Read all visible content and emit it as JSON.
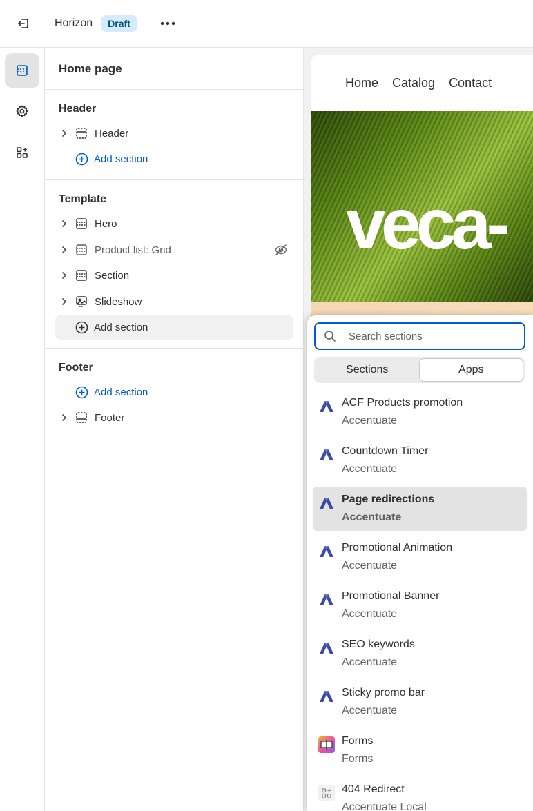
{
  "topbar": {
    "theme_name": "Horizon",
    "status_badge": "Draft"
  },
  "sidebar": {
    "page_title": "Home page",
    "groups": [
      {
        "title": "Header",
        "items": [
          {
            "label": "Header",
            "icon": "header-section-icon"
          }
        ],
        "add_label": "Add section"
      },
      {
        "title": "Template",
        "items": [
          {
            "label": "Hero",
            "icon": "section-icon"
          },
          {
            "label": "Product list: Grid",
            "icon": "section-icon",
            "hidden": true
          },
          {
            "label": "Section",
            "icon": "section-icon"
          },
          {
            "label": "Slideshow",
            "icon": "slideshow-icon"
          }
        ],
        "add_label": "Add section"
      },
      {
        "title": "Footer",
        "add_label": "Add section",
        "items": [
          {
            "label": "Footer",
            "icon": "footer-section-icon"
          }
        ]
      }
    ]
  },
  "preview": {
    "nav": [
      "Home",
      "Catalog",
      "Contact"
    ],
    "hero_text": "veca-"
  },
  "picker": {
    "search_placeholder": "Search sections",
    "tabs": [
      "Sections",
      "Apps"
    ],
    "active_tab": "Apps",
    "apps": [
      {
        "name": "ACF Products promotion",
        "vendor": "Accentuate",
        "logo": "accentuate-logo"
      },
      {
        "name": "Countdown Timer",
        "vendor": "Accentuate",
        "logo": "accentuate-logo"
      },
      {
        "name": "Page redirections",
        "vendor": "Accentuate",
        "logo": "accentuate-logo",
        "selected": true
      },
      {
        "name": "Promotional Animation",
        "vendor": "Accentuate",
        "logo": "accentuate-logo"
      },
      {
        "name": "Promotional Banner",
        "vendor": "Accentuate",
        "logo": "accentuate-logo"
      },
      {
        "name": "SEO keywords",
        "vendor": "Accentuate",
        "logo": "accentuate-logo"
      },
      {
        "name": "Sticky promo bar",
        "vendor": "Accentuate",
        "logo": "accentuate-logo"
      },
      {
        "name": "Forms",
        "vendor": "Forms",
        "logo": "forms-logo"
      },
      {
        "name": "404 Redirect",
        "vendor": "Accentuate Local",
        "logo": "app-blocks-logo"
      }
    ]
  },
  "colors": {
    "accent": "#005bd3",
    "badge_bg": "#d5ebff",
    "badge_text": "#00527c",
    "accentuate_logo": "#3d4aa8"
  }
}
